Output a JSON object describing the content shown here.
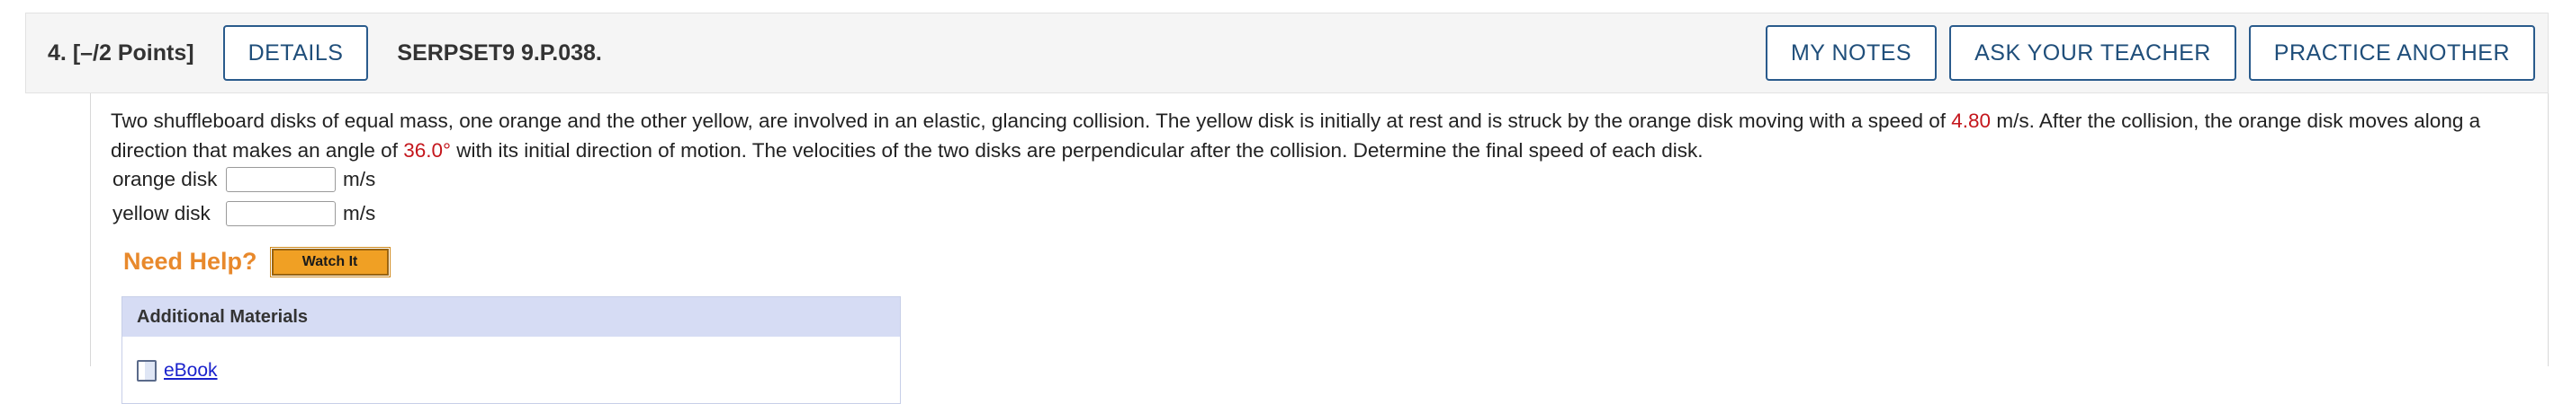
{
  "header": {
    "question_number": "4.",
    "points": "[–/2 Points]",
    "details_label": "DETAILS",
    "problem_code": "SERPSET9 9.P.038.",
    "my_notes_label": "MY NOTES",
    "ask_teacher_label": "ASK YOUR TEACHER",
    "practice_label": "PRACTICE ANOTHER"
  },
  "question": {
    "text_before_speed": "Two shuffleboard disks of equal mass, one orange and the other yellow, are involved in an elastic, glancing collision. The yellow disk is initially at rest and is struck by the orange disk moving with a speed of ",
    "speed": "4.80",
    "text_after_speed": " m/s. After the collision, the orange disk moves along a direction that makes an angle of ",
    "angle": "36.0°",
    "text_end": " with its initial direction of motion. The velocities of the two disks are perpendicular after the collision. Determine the final speed of each disk."
  },
  "answers": [
    {
      "label": "orange disk",
      "value": "",
      "unit": "m/s"
    },
    {
      "label": "yellow disk",
      "value": "",
      "unit": "m/s"
    }
  ],
  "help": {
    "need_help_label": "Need Help?",
    "watch_label": "Watch It"
  },
  "materials": {
    "title": "Additional Materials",
    "ebook_label": "eBook"
  },
  "colors": {
    "button_border": "#2a5b8c",
    "highlight_red": "#c4161c",
    "need_help_orange": "#e8892c",
    "watch_button_fill": "#f0a024",
    "materials_header": "#d6dcf4",
    "link_blue": "#1a22cc"
  },
  "icons": {
    "ebook": "book-icon"
  }
}
